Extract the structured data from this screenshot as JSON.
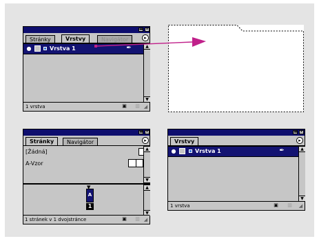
{
  "palette1": {
    "tabs": [
      "Stránky",
      "Vrstvy",
      "Navigátor"
    ],
    "layer_name": "Vrstva 1",
    "status": "1 vrstva"
  },
  "palette2": {
    "tabs": [
      "Stránky",
      "Navigátor"
    ],
    "masters": [
      "[Žádná]",
      "A-Vzor"
    ],
    "page_prefix": "A",
    "page_number": "1",
    "status": "1 stránek v 1 dvojstránce"
  },
  "palette3": {
    "tabs": [
      "Vrstvy"
    ],
    "layer_name": "Vrstva 1",
    "status": "1 vrstva"
  },
  "colors": {
    "titlebar": "#0e0e6e",
    "selected_row": "#131372",
    "layer_swatch": "#3a78d8",
    "arrow": "#c0208a",
    "panel": "#c6c6c6"
  }
}
